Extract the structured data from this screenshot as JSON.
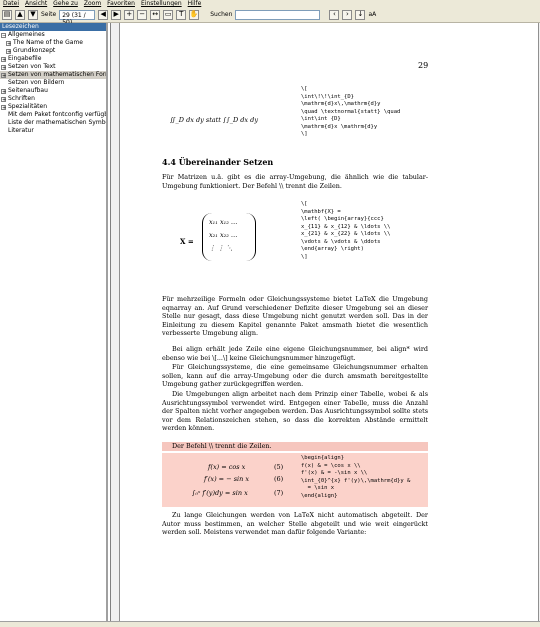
{
  "menu": [
    "Datei",
    "Ansicht",
    "Gehe zu",
    "Zoom",
    "Favoriten",
    "Einstellungen",
    "Hilfe"
  ],
  "toolbar": {
    "page_label": "Seite",
    "page_value": "29 (31 / 50)",
    "search_label": "Suchen",
    "search_value": "",
    "case_label": "aA"
  },
  "sidebar": {
    "title": "Lesezeichen",
    "items": [
      {
        "label": "Allgemeines",
        "expander": "−",
        "level": 0
      },
      {
        "label": "The Name of the Game",
        "expander": "+",
        "level": 1
      },
      {
        "label": "Grundkonzept",
        "expander": "+",
        "level": 1
      },
      {
        "label": "Eingabefile",
        "expander": "+",
        "level": 0
      },
      {
        "label": "Setzen von Text",
        "expander": "+",
        "level": 0
      },
      {
        "label": "Setzen von mathematischen Formeln",
        "expander": "+",
        "level": 0,
        "selected": true
      },
      {
        "label": "Setzen von Bildern",
        "expander": "",
        "level": 0
      },
      {
        "label": "Seitenaufbau",
        "expander": "+",
        "level": 0
      },
      {
        "label": "Schriften",
        "expander": "+",
        "level": 0
      },
      {
        "label": "Spezialitäten",
        "expander": "+",
        "level": 0
      },
      {
        "label": "Mit dem Paket fontconfig verfügbare Symbole",
        "expander": "",
        "level": 0
      },
      {
        "label": "Liste der mathematischen Symbole",
        "expander": "",
        "level": 0
      },
      {
        "label": "Literatur",
        "expander": "",
        "level": 0
      }
    ]
  },
  "page": {
    "number": "29",
    "top_math": "∬_D dx dy   statt   ∫∫_D dx dy",
    "top_code": "\\[\n\\int\\!\\!\\int_{D}\n\\mathrm{d}x\\,\\mathrm{d}y\n\\quad \\textnormal{statt} \\quad\n\\int\\int {D}\n\\mathrm{d}x \\mathrm{d}y\n\\]",
    "heading": "4.4  Übereinander Setzen",
    "intro": "Für Matrizen u.ä. gibt es die array-Umgebung, die ähnlich wie die tabular-Umgebung funktioniert. Der Befehl \\\\ trennt die Zeilen.",
    "matrix_label": "X =",
    "matrix_rows": [
      "x₁₁  x₁₂  …",
      "x₂₁  x₂₂  …",
      "⋮    ⋮    ⋱"
    ],
    "matrix_code": "\\[\n\\mathbf{X} =\n\\left( \\begin{array}{ccc}\nx_{11} & x_{12} & \\ldots \\\\\nx_{21} & x_{22} & \\ldots \\\\\n\\vdots & \\vdots & \\ddots\n\\end{array} \\right)\n\\]",
    "para1": "Für mehrzeilige Formeln oder Gleichungssysteme bietet LaTeX die Umgebung eqnarray an. Auf Grund verschiedener Defizite dieser Umgebung sei an dieser Stelle nur gesagt, dass diese Umgebung nicht genutzt werden soll. Das in der Einleitung zu diesem Kapitel genannte Paket amsmath bietet die wesentlich verbesserte Umgebung align.",
    "para2": "Bei align erhält jede Zeile eine eigene Gleichungsnummer, bei align* wird ebenso wie bei \\[...\\] keine Gleichungsnummer hinzugefügt.",
    "para3": "Für Gleichungssysteme, die eine gemeinsame Gleichungsnummer erhalten sollen, kann auf die array-Umgebung oder die durch amsmath bereitgestellte Umgebung gather zurückgegriffen werden.",
    "para4": "Die Umgebungen align arbeitet nach dem Prinzip einer Tabelle, wobei & als Ausrichtungssymbol verwendet wird. Entgegen einer Tabelle, muss die Anzahl der Spalten nicht vorher angegeben werden. Das Ausrichtungssymbol sollte stets vor dem Relationszeichen stehen, so dass die korrekten Abstände ermittelt werden können.",
    "highlight_line": "Der Befehl \\\\ trennt die Zeilen.",
    "align_eqs": [
      {
        "eq": "f(x) = cos x",
        "num": "(5)"
      },
      {
        "eq": "f′(x) = − sin x",
        "num": "(6)"
      },
      {
        "eq": "∫₀ˣ f′(y)dy = sin x",
        "num": "(7)"
      }
    ],
    "align_code": "\\begin{align}\nf(x) & = \\cos x \\\\\nf'(x) & = -\\sin x \\\\\n\\int_{0}^{x} f'(y)\\,\\mathrm{d}y &\n  = \\sin x\n\\end{align}",
    "para5": "Zu lange Gleichungen werden von LaTeX nicht automatisch abgeteilt. Der Autor muss bestimmen, an welcher Stelle abgeteilt und wie weit eingerückt werden soll. Meistens verwendet man dafür folgende Variante:"
  }
}
